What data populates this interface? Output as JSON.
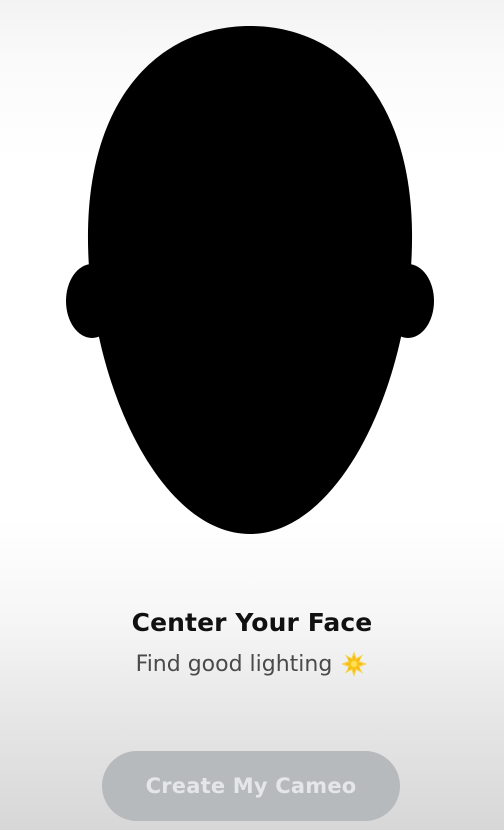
{
  "prompt": {
    "title": "Center Your Face",
    "subtitle": "Find good lighting",
    "subtitle_icon": "sun-icon"
  },
  "action": {
    "button_label": "Create My Cameo",
    "enabled": false
  },
  "colors": {
    "silhouette": "#000000",
    "title": "#111111",
    "subtitle": "#4a4a4a",
    "button_bg_disabled": "#b6babd",
    "button_text_disabled": "#e4e6e7",
    "sun": "#f4c21f"
  }
}
